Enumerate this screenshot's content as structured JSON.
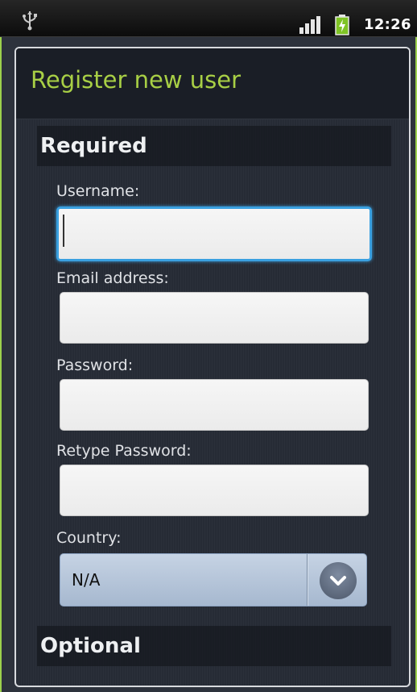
{
  "status_bar": {
    "time": "12:26",
    "icons": [
      "usb-icon",
      "signal-icon",
      "battery-charging-icon"
    ]
  },
  "dialog": {
    "title": "Register new user"
  },
  "sections": {
    "required": "Required",
    "optional": "Optional"
  },
  "fields": {
    "username": {
      "label": "Username:",
      "value": ""
    },
    "email": {
      "label": "Email address:",
      "value": ""
    },
    "password": {
      "label": "Password:",
      "value": ""
    },
    "retype_password": {
      "label": "Retype Password:",
      "value": ""
    },
    "country": {
      "label": "Country:",
      "value": "N/A"
    }
  },
  "colors": {
    "title": "#a8cf45",
    "frame": "#9cd14c",
    "focus": "#3aa0e0"
  }
}
